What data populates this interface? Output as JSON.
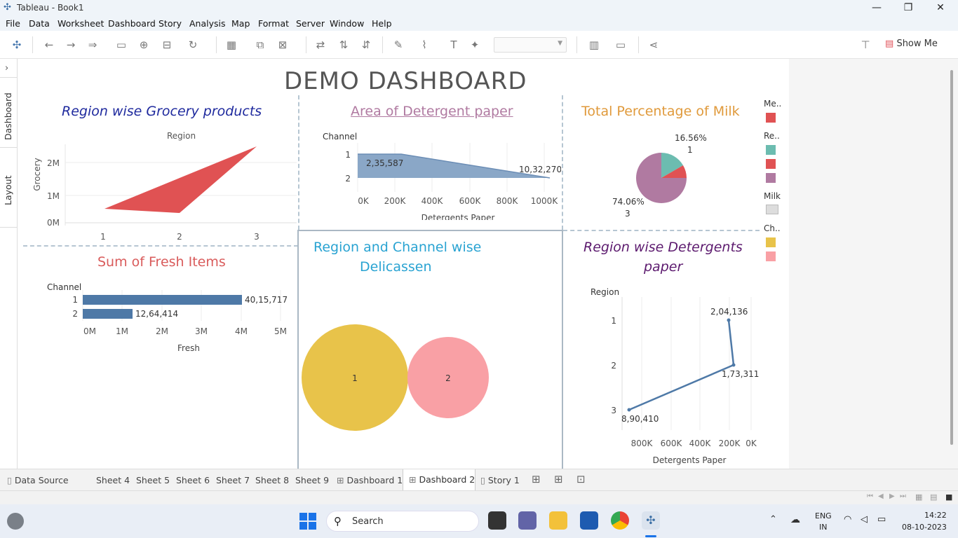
{
  "window": {
    "title": "Tableau - Book1"
  },
  "menu": [
    "File",
    "Data",
    "Worksheet",
    "Dashboard",
    "Story",
    "Analysis",
    "Map",
    "Format",
    "Server",
    "Window",
    "Help"
  ],
  "toolbar": {
    "show_me": "Show Me"
  },
  "side_tabs": {
    "dashboard": "Dashboard",
    "layout": "Layout"
  },
  "dashboard": {
    "title": "DEMO DASHBOARD"
  },
  "charts": {
    "grocery": {
      "title": "Region wise Grocery  products",
      "header": "Region",
      "ylabel": "Grocery",
      "yticks": [
        "2M",
        "1M",
        "0M"
      ],
      "xticks": [
        "1",
        "2",
        "3"
      ]
    },
    "detergent_area": {
      "title": "Area of Detergent paper",
      "header": "Channel",
      "rows": [
        "1",
        "2"
      ],
      "label1": "2,35,587",
      "label2": "10,32,270",
      "xticks": [
        "0K",
        "200K",
        "400K",
        "600K",
        "800K",
        "1000K"
      ],
      "xlabel": "Detergents Paper"
    },
    "milk": {
      "title": "Total Percentage of Milk",
      "pct1": "16.56%",
      "id1": "1",
      "pct3": "74.06%",
      "id3": "3"
    },
    "fresh": {
      "title": "Sum of Fresh Items",
      "header": "Channel",
      "rows": [
        "1",
        "2"
      ],
      "values": [
        "40,15,717",
        "12,64,414"
      ],
      "xticks": [
        "0M",
        "1M",
        "2M",
        "3M",
        "4M",
        "5M"
      ],
      "xlabel": "Fresh"
    },
    "delicassen": {
      "title1": "Region and Channel wise",
      "title2": "Delicassen",
      "b1": "1",
      "b2": "2"
    },
    "detergent_region": {
      "title1": "Region wise Detergents",
      "title2": "paper",
      "header": "Region",
      "rows": [
        "1",
        "2",
        "3"
      ],
      "l1": "2,04,136",
      "l2": "1,73,311",
      "l3": "8,90,410",
      "xticks": [
        "800K",
        "600K",
        "400K",
        "200K",
        "0K"
      ],
      "xlabel": "Detergents Paper"
    }
  },
  "legend": {
    "t1": "Me..",
    "t2": "Re..",
    "t3": "Milk",
    "t4": "Ch.."
  },
  "colors": {
    "red": "#e05253",
    "teal": "#6cbcb0",
    "purple": "#b07aa1",
    "yellow": "#e8c34a",
    "pink": "#f9a0a5",
    "blue": "#4e79a7",
    "area": "#8aa7c7"
  },
  "sheet_tabs": {
    "datasource": "Data Source",
    "s4": "Sheet 4",
    "s5": "Sheet 5",
    "s6": "Sheet 6",
    "s7": "Sheet 7",
    "s8": "Sheet 8",
    "s9": "Sheet 9",
    "d1": "Dashboard 1",
    "d2": "Dashboard 2",
    "story": "Story 1"
  },
  "taskbar": {
    "search": "Search",
    "lang1": "ENG",
    "lang2": "IN",
    "time": "14:22",
    "date": "08-10-2023"
  },
  "chart_data": [
    {
      "type": "area",
      "title": "Region wise Grocery  products",
      "x": [
        1,
        2,
        3
      ],
      "ylabel": "Grocery",
      "yticks": [
        "0M",
        "1M",
        "2M"
      ]
    },
    {
      "type": "area",
      "title": "Area of Detergent paper",
      "categories": [
        "1",
        "2"
      ],
      "values": [
        235587,
        1032270
      ],
      "xlabel": "Detergents Paper",
      "xlim": [
        0,
        1000000
      ]
    },
    {
      "type": "pie",
      "title": "Total Percentage of Milk",
      "slices": [
        {
          "label": "1",
          "value": 16.56
        },
        {
          "label": "3",
          "value": 74.06
        }
      ]
    },
    {
      "type": "bar",
      "title": "Sum of Fresh Items",
      "categories": [
        "1",
        "2"
      ],
      "values": [
        4015717,
        1264414
      ],
      "xlabel": "Fresh",
      "xlim": [
        0,
        5000000
      ]
    },
    {
      "type": "scatter",
      "title": "Region and Channel wise Delicassen",
      "categories": [
        "1",
        "2"
      ]
    },
    {
      "type": "line",
      "title": "Region wise Detergents paper",
      "categories": [
        "1",
        "2",
        "3"
      ],
      "values": [
        204136,
        173311,
        890410
      ],
      "xlabel": "Detergents Paper",
      "xlim": [
        0,
        900000
      ]
    }
  ]
}
